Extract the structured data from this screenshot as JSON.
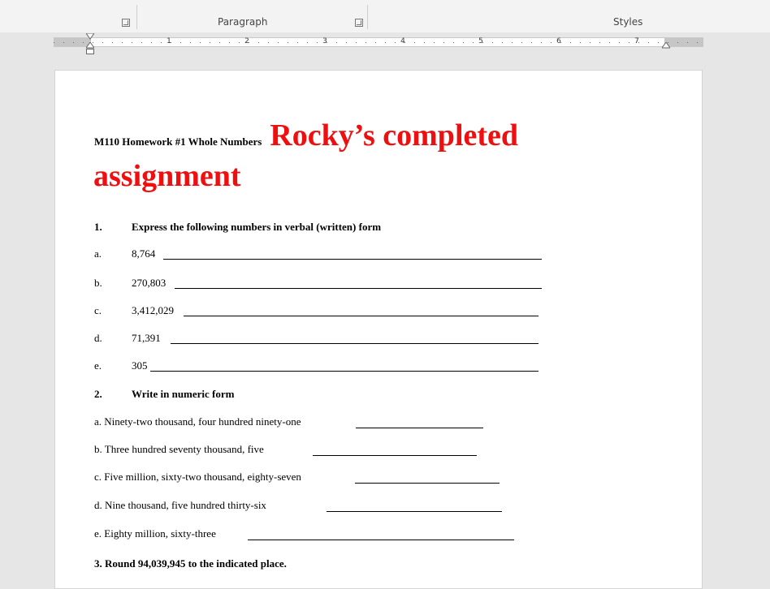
{
  "ribbon": {
    "paragraph_label": "Paragraph",
    "styles_label": "Styles"
  },
  "ruler": {
    "numbers": [
      "1",
      "2",
      "3",
      "4",
      "5",
      "6",
      "7"
    ]
  },
  "document": {
    "title_small": "M110 Homework #1 Whole Numbers",
    "title_big_1": "Rocky’s completed",
    "title_big_2": "assignment",
    "title_color": "#ee1010",
    "q1": {
      "num": "1.",
      "text": "Express the following numbers in verbal (written) form",
      "items": [
        {
          "label": "a.",
          "value": "8,764"
        },
        {
          "label": "b.",
          "value": "270,803"
        },
        {
          "label": "c.",
          "value": "3,412,029"
        },
        {
          "label": "d.",
          "value": "71,391"
        },
        {
          "label": "e.",
          "value": "305"
        }
      ]
    },
    "q2": {
      "num": "2.",
      "text": "Write in numeric form",
      "items": [
        "a.  Ninety-two thousand, four hundred ninety-one",
        "b.  Three hundred seventy thousand, five",
        "c.  Five million,  sixty-two thousand, eighty-seven",
        "d. Nine thousand, five hundred thirty-six",
        "e. Eighty million, sixty-three"
      ]
    },
    "q3": {
      "text": "3.  Round  94,039,945 to the indicated place."
    }
  }
}
